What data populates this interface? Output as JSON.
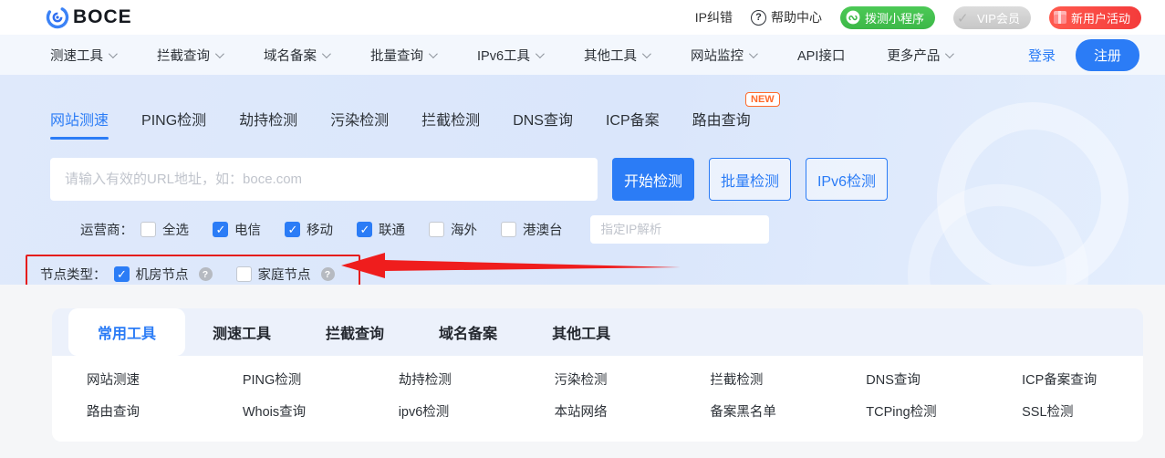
{
  "topbar": {
    "logo_text": "BOCE",
    "ip_correction": "IP纠错",
    "help_center": "帮助中心",
    "miniprogram_badge": "拨测小程序",
    "vip_badge": "VIP会员",
    "new_user_badge": "新用户活动"
  },
  "navbar": {
    "items": [
      "测速工具",
      "拦截查询",
      "域名备案",
      "批量查询",
      "IPv6工具",
      "其他工具",
      "网站监控",
      "API接口",
      "更多产品"
    ],
    "login_label": "登录",
    "register_label": "注册"
  },
  "hero": {
    "tabs": [
      "网站测速",
      "PING检测",
      "劫持检测",
      "污染检测",
      "拦截检测",
      "DNS查询",
      "ICP备案",
      "路由查询"
    ],
    "active_tab": "网站测速",
    "new_badge": "NEW",
    "search_placeholder": "请输入有效的URL地址，如：boce.com",
    "start_button": "开始检测",
    "batch_button": "批量检测",
    "ipv6_button": "IPv6检测",
    "operator_label": "运营商：",
    "operators": [
      {
        "label": "全选",
        "checked": false
      },
      {
        "label": "电信",
        "checked": true
      },
      {
        "label": "移动",
        "checked": true
      },
      {
        "label": "联通",
        "checked": true
      },
      {
        "label": "海外",
        "checked": false
      },
      {
        "label": "港澳台",
        "checked": false
      }
    ],
    "ip_placeholder": "指定IP解析",
    "node_label": "节点类型：",
    "nodes": [
      {
        "label": "机房节点",
        "checked": true,
        "help_icon": "question-mark"
      },
      {
        "label": "家庭节点",
        "checked": false,
        "help_icon": "question-mark"
      }
    ]
  },
  "tools": {
    "tabs": [
      "常用工具",
      "测速工具",
      "拦截查询",
      "域名备案",
      "其他工具"
    ],
    "active_tab": "常用工具",
    "links_row1": [
      "网站测速",
      "PING检测",
      "劫持检测",
      "污染检测",
      "拦截检测",
      "DNS查询",
      "ICP备案查询"
    ],
    "links_row2": [
      "路由查询",
      "Whois查询",
      "ipv6检测",
      "本站网络",
      "备案黑名单",
      "TCPing检测",
      "SSL检测"
    ]
  },
  "colors": {
    "primary_blue": "#2b7cf6",
    "annotation_red": "#e51c1c",
    "badge_green": "#3cb848",
    "badge_red": "#f43b3b",
    "new_badge_orange": "#ff6a2b",
    "hero_background": "#dbe7fc"
  }
}
